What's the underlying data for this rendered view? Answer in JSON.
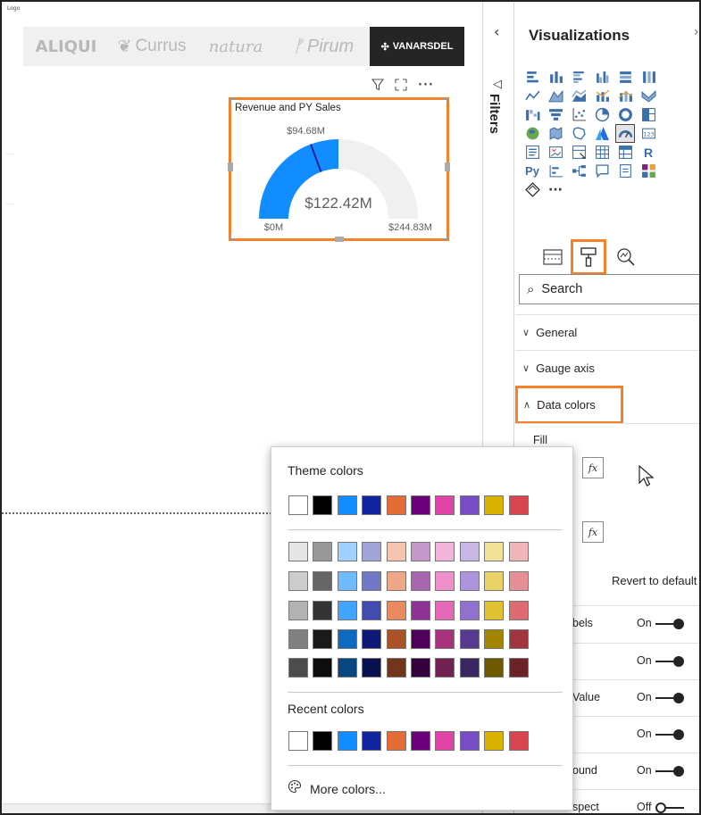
{
  "canvas": {
    "logo_label": "Logo",
    "brands": [
      {
        "label": "ALIQUI"
      },
      {
        "label": "Currus"
      },
      {
        "label": "natura"
      },
      {
        "label": "Pirum"
      },
      {
        "label": "VANARSDEL"
      }
    ],
    "visual": {
      "title": "Revenue and PY Sales",
      "header_icons": [
        "filter-icon",
        "focus-mode-icon",
        "more-options-icon"
      ]
    }
  },
  "chart_data": {
    "type": "gauge",
    "title": "Revenue and PY Sales",
    "value": 122.42,
    "value_label": "$122.42M",
    "min": 0,
    "min_label": "$0M",
    "max": 244.83,
    "max_label": "$244.83M",
    "target": 94.68,
    "target_label": "$94.68M",
    "fill_color": "#118dff",
    "track_color": "#f0f0f0",
    "target_color": "#12239e"
  },
  "filters": {
    "label": "Filters",
    "collapse_icon": "chevron-left-icon",
    "filter_icon": "filter-outline-icon"
  },
  "viz_pane": {
    "title": "Visualizations",
    "tabs": [
      "fields-tab-icon",
      "format-paintbrush-icon",
      "analytics-icon"
    ],
    "search_placeholder": "Search",
    "sections": {
      "general": "General",
      "gauge_axis": "Gauge axis",
      "data_colors": "Data colors"
    },
    "fill_label": "Fill",
    "fx_label": "fx",
    "revert_label": "Revert to default",
    "rows": [
      {
        "label": "bels",
        "state": "On"
      },
      {
        "label": "",
        "state": "On"
      },
      {
        "label": "Value",
        "state": "On"
      },
      {
        "label": "",
        "state": "On"
      },
      {
        "label": "ound",
        "state": "On"
      },
      {
        "label": "spect",
        "state": "Off"
      }
    ]
  },
  "picker": {
    "theme_title": "Theme colors",
    "recent_title": "Recent colors",
    "more_label": "More colors...",
    "theme_colors": [
      "#ffffff",
      "#000000",
      "#118dff",
      "#12239e",
      "#e66c37",
      "#6b007b",
      "#e044a7",
      "#744ec2",
      "#d9b300",
      "#d64550"
    ],
    "shades": [
      [
        "#e6e6e6",
        "#999999",
        "#a0d1ff",
        "#a0a7d8",
        "#f5c4af",
        "#c499ca",
        "#f3b4dc",
        "#c7b8e7",
        "#f0e199",
        "#efb5b9"
      ],
      [
        "#cccccc",
        "#666666",
        "#70bbff",
        "#7079c5",
        "#f0a787",
        "#a866b0",
        "#ec8fca",
        "#ac95dd",
        "#e8d166",
        "#e68f96"
      ],
      [
        "#b3b3b3",
        "#333333",
        "#41a4ff",
        "#414cb1",
        "#eb8a5f",
        "#8c3395",
        "#e669b9",
        "#9071ce",
        "#e1c233",
        "#de6a73"
      ],
      [
        "#808080",
        "#1a1a1a",
        "#0d6abf",
        "#0d1a77",
        "#ad5129",
        "#50005c",
        "#a8337d",
        "#573a92",
        "#a38600",
        "#a1343c"
      ],
      [
        "#4d4d4d",
        "#0d0d0d",
        "#094780",
        "#09114f",
        "#73361c",
        "#36003e",
        "#702253",
        "#3a2761",
        "#6d5a00",
        "#6b2328"
      ]
    ],
    "recent_colors": [
      "#ffffff",
      "#000000",
      "#118dff",
      "#12239e",
      "#e66c37",
      "#6b007b",
      "#e044a7",
      "#744ec2",
      "#d9b300",
      "#d64550"
    ]
  }
}
